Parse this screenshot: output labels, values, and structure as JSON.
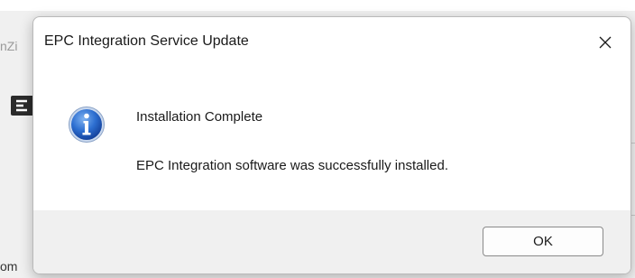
{
  "background": {
    "left_text_top": "nZi",
    "left_text_bottom": "om"
  },
  "dialog": {
    "title": "EPC Integration Service Update",
    "close_glyph": "✕",
    "icon": "info-icon",
    "icon_color": "#1f5fbf",
    "heading": "Installation Complete",
    "message": "EPC Integration software was successfully installed.",
    "ok_label": "OK"
  }
}
